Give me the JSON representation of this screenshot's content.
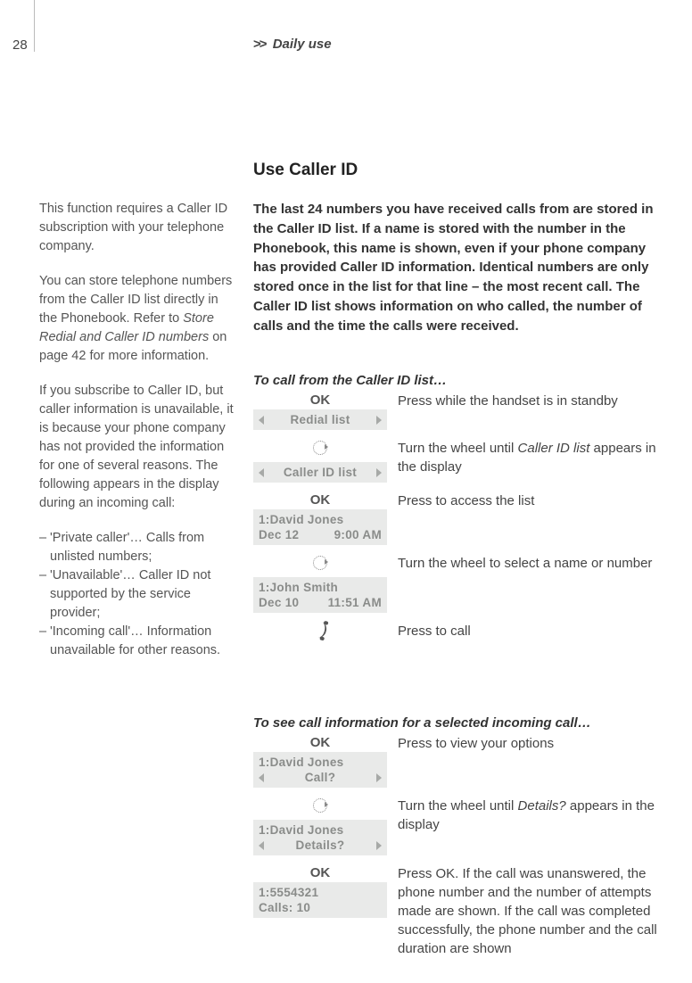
{
  "page_number": "28",
  "section_header": "Daily use",
  "heading": "Use Caller ID",
  "intro": "The last 24 numbers you have received calls from are stored in the Caller ID list. If a name is stored with the number in the Phonebook, this name is shown, even if your phone company has provided Caller ID information. Identical numbers are only stored once in the list for that line – the most recent call. The Caller ID list shows information on who called, the number of calls and the time the calls were received.",
  "sidebar": {
    "p1": "This function requires a Caller ID subscription with your telephone company.",
    "p2a": "You can store telephone numbers from the Caller ID list directly in the Phonebook. Refer to ",
    "p2i": "Store Redial and Caller ID numbers",
    "p2b": " on page 42 for more information.",
    "p3": "If you subscribe to Caller ID, but caller information is unavailable, it is because your phone company has not provided the information for one of several reasons. The following appears in the display during an incoming call:",
    "b1": "'Private caller'… Calls from unlisted numbers;",
    "b2": "'Unavailable'… Caller ID not supported by the service provider;",
    "b3": "'Incoming call'… Information unavailable for other reasons."
  },
  "sub1": "To call from the Caller ID list…",
  "steps1": {
    "s1": {
      "top": "OK",
      "menu": "Redial list",
      "desc": "Press while the handset is in standby"
    },
    "s2": {
      "menu": "Caller ID list",
      "desc_a": "Turn the wheel until ",
      "desc_i": "Caller ID list",
      "desc_b": " appears in the display"
    },
    "s3": {
      "top": "OK",
      "l1": "1:David Jones",
      "l2a": "Dec 12",
      "l2b": "9:00 AM",
      "desc": "Press to access the list"
    },
    "s4": {
      "l1": "1:John Smith",
      "l2a": "Dec 10",
      "l2b": "11:51 AM",
      "desc": "Turn the wheel to select a name or number"
    },
    "s5": {
      "desc": "Press to call"
    }
  },
  "sub2": "To see call information for a selected incoming call…",
  "steps2": {
    "s1": {
      "top": "OK",
      "l1": "1:David Jones",
      "menu": "Call?",
      "desc": "Press to view your options"
    },
    "s2": {
      "l1": "1:David Jones",
      "menu": "Details?",
      "desc_a": "Turn the wheel until ",
      "desc_i": "Details?",
      "desc_b": " appears in the display"
    },
    "s3": {
      "top": "OK",
      "l1": "1:5554321",
      "l2": "Calls: 10",
      "desc": "Press OK. If the call was unanswered, the phone number and the number of attempts made are shown. If the call was completed successfully, the phone number and the call duration are shown"
    }
  }
}
